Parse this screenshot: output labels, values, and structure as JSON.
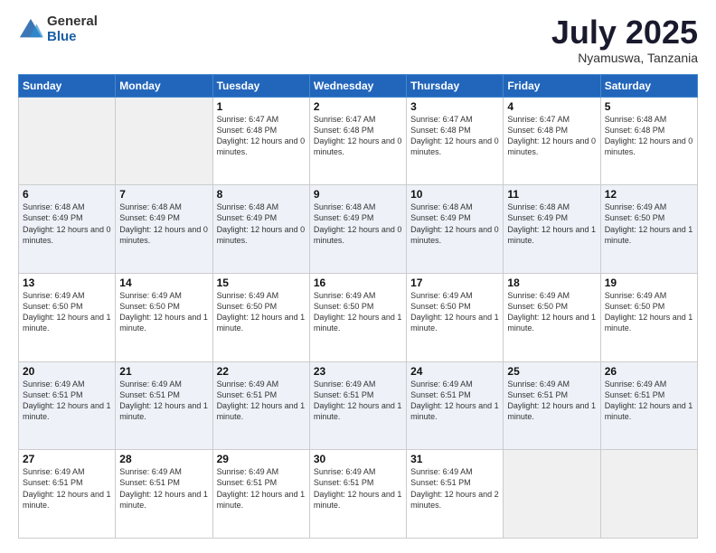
{
  "logo": {
    "general": "General",
    "blue": "Blue"
  },
  "header": {
    "month": "July 2025",
    "location": "Nyamuswa, Tanzania"
  },
  "weekdays": [
    "Sunday",
    "Monday",
    "Tuesday",
    "Wednesday",
    "Thursday",
    "Friday",
    "Saturday"
  ],
  "rows": [
    [
      {
        "day": "",
        "info": ""
      },
      {
        "day": "",
        "info": ""
      },
      {
        "day": "1",
        "info": "Sunrise: 6:47 AM\nSunset: 6:48 PM\nDaylight: 12 hours and 0 minutes."
      },
      {
        "day": "2",
        "info": "Sunrise: 6:47 AM\nSunset: 6:48 PM\nDaylight: 12 hours and 0 minutes."
      },
      {
        "day": "3",
        "info": "Sunrise: 6:47 AM\nSunset: 6:48 PM\nDaylight: 12 hours and 0 minutes."
      },
      {
        "day": "4",
        "info": "Sunrise: 6:47 AM\nSunset: 6:48 PM\nDaylight: 12 hours and 0 minutes."
      },
      {
        "day": "5",
        "info": "Sunrise: 6:48 AM\nSunset: 6:48 PM\nDaylight: 12 hours and 0 minutes."
      }
    ],
    [
      {
        "day": "6",
        "info": "Sunrise: 6:48 AM\nSunset: 6:49 PM\nDaylight: 12 hours and 0 minutes."
      },
      {
        "day": "7",
        "info": "Sunrise: 6:48 AM\nSunset: 6:49 PM\nDaylight: 12 hours and 0 minutes."
      },
      {
        "day": "8",
        "info": "Sunrise: 6:48 AM\nSunset: 6:49 PM\nDaylight: 12 hours and 0 minutes."
      },
      {
        "day": "9",
        "info": "Sunrise: 6:48 AM\nSunset: 6:49 PM\nDaylight: 12 hours and 0 minutes."
      },
      {
        "day": "10",
        "info": "Sunrise: 6:48 AM\nSunset: 6:49 PM\nDaylight: 12 hours and 0 minutes."
      },
      {
        "day": "11",
        "info": "Sunrise: 6:48 AM\nSunset: 6:49 PM\nDaylight: 12 hours and 1 minute."
      },
      {
        "day": "12",
        "info": "Sunrise: 6:49 AM\nSunset: 6:50 PM\nDaylight: 12 hours and 1 minute."
      }
    ],
    [
      {
        "day": "13",
        "info": "Sunrise: 6:49 AM\nSunset: 6:50 PM\nDaylight: 12 hours and 1 minute."
      },
      {
        "day": "14",
        "info": "Sunrise: 6:49 AM\nSunset: 6:50 PM\nDaylight: 12 hours and 1 minute."
      },
      {
        "day": "15",
        "info": "Sunrise: 6:49 AM\nSunset: 6:50 PM\nDaylight: 12 hours and 1 minute."
      },
      {
        "day": "16",
        "info": "Sunrise: 6:49 AM\nSunset: 6:50 PM\nDaylight: 12 hours and 1 minute."
      },
      {
        "day": "17",
        "info": "Sunrise: 6:49 AM\nSunset: 6:50 PM\nDaylight: 12 hours and 1 minute."
      },
      {
        "day": "18",
        "info": "Sunrise: 6:49 AM\nSunset: 6:50 PM\nDaylight: 12 hours and 1 minute."
      },
      {
        "day": "19",
        "info": "Sunrise: 6:49 AM\nSunset: 6:50 PM\nDaylight: 12 hours and 1 minute."
      }
    ],
    [
      {
        "day": "20",
        "info": "Sunrise: 6:49 AM\nSunset: 6:51 PM\nDaylight: 12 hours and 1 minute."
      },
      {
        "day": "21",
        "info": "Sunrise: 6:49 AM\nSunset: 6:51 PM\nDaylight: 12 hours and 1 minute."
      },
      {
        "day": "22",
        "info": "Sunrise: 6:49 AM\nSunset: 6:51 PM\nDaylight: 12 hours and 1 minute."
      },
      {
        "day": "23",
        "info": "Sunrise: 6:49 AM\nSunset: 6:51 PM\nDaylight: 12 hours and 1 minute."
      },
      {
        "day": "24",
        "info": "Sunrise: 6:49 AM\nSunset: 6:51 PM\nDaylight: 12 hours and 1 minute."
      },
      {
        "day": "25",
        "info": "Sunrise: 6:49 AM\nSunset: 6:51 PM\nDaylight: 12 hours and 1 minute."
      },
      {
        "day": "26",
        "info": "Sunrise: 6:49 AM\nSunset: 6:51 PM\nDaylight: 12 hours and 1 minute."
      }
    ],
    [
      {
        "day": "27",
        "info": "Sunrise: 6:49 AM\nSunset: 6:51 PM\nDaylight: 12 hours and 1 minute."
      },
      {
        "day": "28",
        "info": "Sunrise: 6:49 AM\nSunset: 6:51 PM\nDaylight: 12 hours and 1 minute."
      },
      {
        "day": "29",
        "info": "Sunrise: 6:49 AM\nSunset: 6:51 PM\nDaylight: 12 hours and 1 minute."
      },
      {
        "day": "30",
        "info": "Sunrise: 6:49 AM\nSunset: 6:51 PM\nDaylight: 12 hours and 1 minute."
      },
      {
        "day": "31",
        "info": "Sunrise: 6:49 AM\nSunset: 6:51 PM\nDaylight: 12 hours and 2 minutes."
      },
      {
        "day": "",
        "info": ""
      },
      {
        "day": "",
        "info": ""
      }
    ]
  ]
}
